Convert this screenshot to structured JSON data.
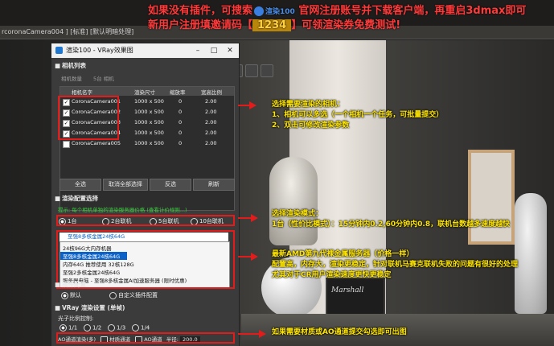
{
  "banner": {
    "line1": "如果没有插件，可搜索",
    "line1_brand": "渲染100",
    "line1_rest": "官网注册账号并下载客户端，再重启3dmax即可",
    "line2": "新用户注册填邀请码【",
    "line2_code": "1234",
    "line2_rest": "】可领渲染券免费测试!"
  },
  "viewport": {
    "tab_left": "rcoronaCamera004 ] [标准] [默认明暗处理]"
  },
  "dialog": {
    "title": "渲染100 - VRay效果图",
    "camera_section": "相机列表",
    "camera_hint_left": "相机数量",
    "camera_hint_right": "5台 相机",
    "columns": [
      "相机名字",
      "渲染尺寸",
      "缩放率",
      "宽高比例"
    ],
    "cameras": [
      {
        "name": "CoronaCamera001",
        "size": "1000 x 500",
        "scale": "0",
        "ratio": "2.00",
        "checked": true
      },
      {
        "name": "CoronaCamera002",
        "size": "1000 x 500",
        "scale": "0",
        "ratio": "2.00",
        "checked": true
      },
      {
        "name": "CoronaCamera003",
        "size": "1000 x 500",
        "scale": "0",
        "ratio": "2.00",
        "checked": true
      },
      {
        "name": "CoronaCamera004",
        "size": "1000 x 500",
        "scale": "0",
        "ratio": "2.00",
        "checked": true
      },
      {
        "name": "CoronaCamera005",
        "size": "1000 x 500",
        "scale": "0",
        "ratio": "2.00",
        "checked": false
      }
    ],
    "cam_buttons": [
      "全选",
      "取消全部选择",
      "反选",
      "刷新"
    ],
    "render_section": "渲染配置选择",
    "render_hint": "提示: 每个相机单独的渲染服务器价格 (查看计价规则...)",
    "modes": [
      "1台",
      "2台联机",
      "5台联机",
      "10台联机"
    ],
    "server_selected": "至强8多核金属24核64G",
    "server_options": [
      "24核96G大内存机器",
      "至强8多核金属24核64G",
      "内存64G 推荐使用 32核128G",
      "至强2多核金属24核64G",
      "服务器电脑 - 至强8多核金属AI加速服务器 (限时优惠)"
    ],
    "plugin_section": "插件配置",
    "plugin_default": "默认",
    "plugin_custom": "自定义插件配置",
    "vray_section": "VRay 渲染设置 (单帧)",
    "gi_label": "光子比例控制:",
    "gi_options": [
      "1/1",
      "1/2",
      "1/3",
      "1/4"
    ],
    "last_row": {
      "ao_label": "AO通道渲染(多)",
      "material_label": "材质通道",
      "ao_channel_label": "AO通道",
      "distance_label": "半径:",
      "distance_value": "200.0"
    }
  },
  "annotations": [
    {
      "lines": [
        "选择需要渲染的相机：",
        "1、相机可以多选（一个相机一个任务，可批量提交）",
        "2、双击可修改渲染参数"
      ]
    },
    {
      "lines": [
        "选择渲染模式：",
        "1台（性价比模式）：15分钟内0.2,60分钟内0.8，联机台数越多速度越快"
      ]
    },
    {
      "lines": [
        "最新AMD第九代裸金属服务器（价格一样）",
        "配置高，内存大，渲染更稳定，针对联机马赛克联机失败的问题有很好的处理",
        "尤其对于CR用户渲染速度更快更稳定"
      ]
    },
    {
      "lines": [
        "如果需要材质或AO通道提交勾选即可出图"
      ]
    }
  ],
  "scene": {
    "speaker_brand": "Marshall"
  },
  "colors": {
    "annotation_red": "#e21b1b",
    "annotation_yellow": "#ffe600",
    "banner_red": "#ff3a3a",
    "selection_blue": "#0a62c9"
  }
}
